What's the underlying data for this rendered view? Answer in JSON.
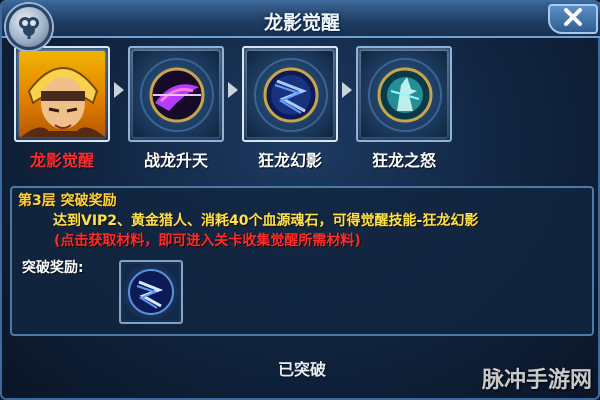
{
  "window": {
    "title": "龙影觉醒",
    "close_icon": "close-icon",
    "logo_icon": "clover-logo"
  },
  "stages": [
    {
      "label": "龙影觉醒",
      "icon": "hero-portrait",
      "active": true,
      "color": "#ff2a2a"
    },
    {
      "label": "战龙升天",
      "icon": "purple-dragon-orb",
      "active": false,
      "color": "#ffffff"
    },
    {
      "label": "狂龙幻影",
      "icon": "blue-lightning-orb",
      "active": true,
      "color": "#ffffff"
    },
    {
      "label": "狂龙之怒",
      "icon": "cyan-spirit-orb",
      "active": false,
      "color": "#ffffff"
    }
  ],
  "panel": {
    "layer_title": "第3层 突破奖励",
    "requirement": "达到VIP2、黄金猎人、消耗40个血源魂石，可得觉醒技能-狂龙幻影",
    "hint": "(点击获取材料，即可进入关卡收集觉醒所需材料)",
    "reward_label": "突破奖励:",
    "reward_icon": "blue-lightning-skill-icon"
  },
  "status": {
    "text": "已突破"
  },
  "watermark": "脉冲手游网"
}
